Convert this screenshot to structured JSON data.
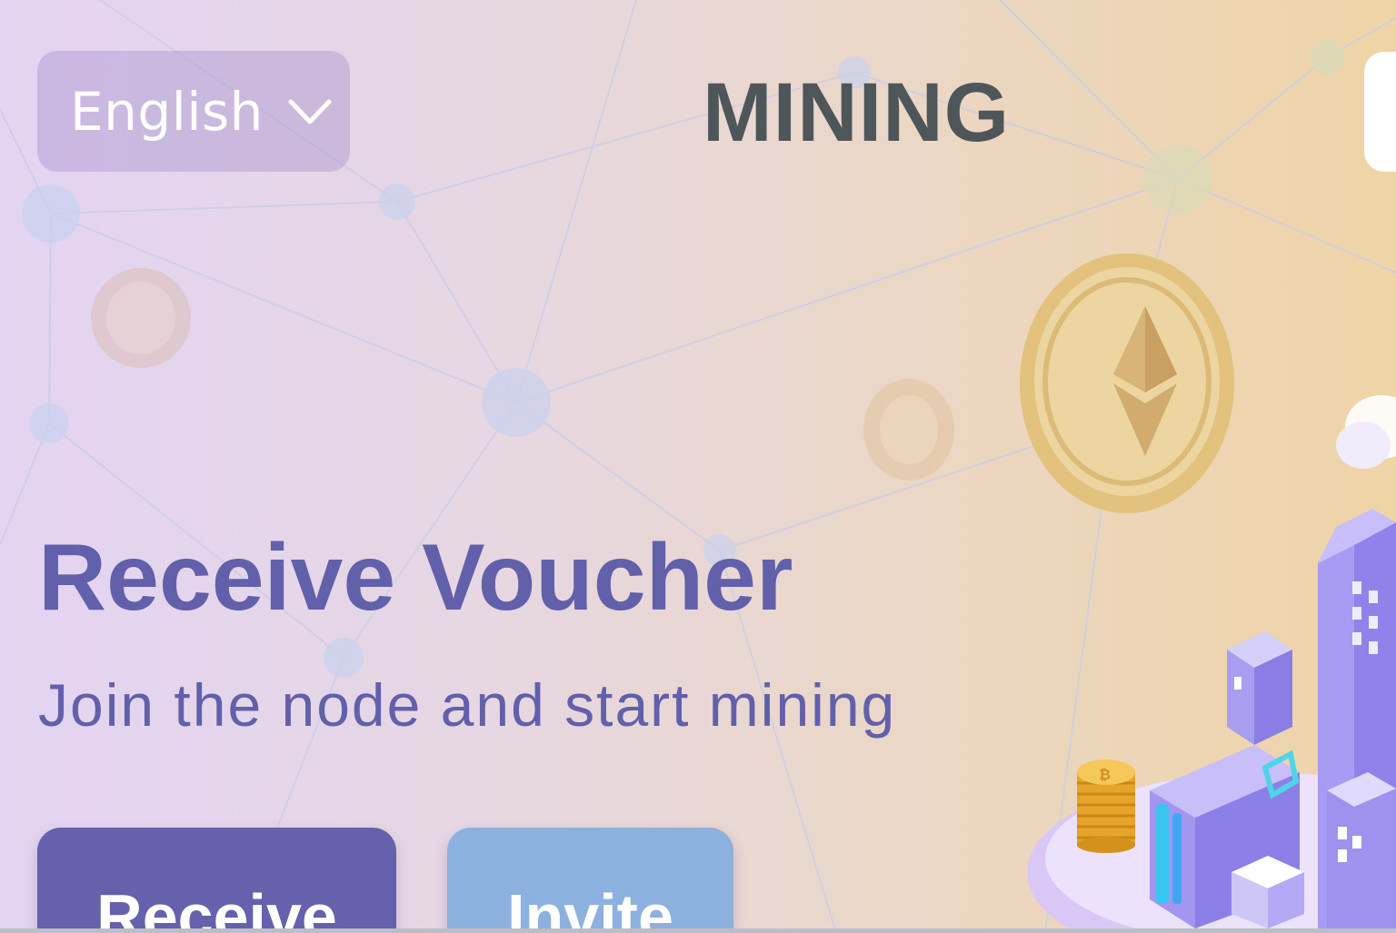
{
  "header": {
    "language_label": "English",
    "brand_title": "MINING"
  },
  "hero": {
    "headline": "Receive Voucher",
    "subtitle": "Join the node and start mining"
  },
  "actions": {
    "receive_label": "Receive",
    "invite_label": "Invite"
  },
  "icons": {
    "language_dropdown": "chevron-down-icon",
    "coin": "ethereum-coin-icon"
  },
  "colors": {
    "accent": "#6260aa",
    "receive_button": "#6561ad",
    "invite_button": "#8db1de",
    "title": "#4f5659"
  }
}
